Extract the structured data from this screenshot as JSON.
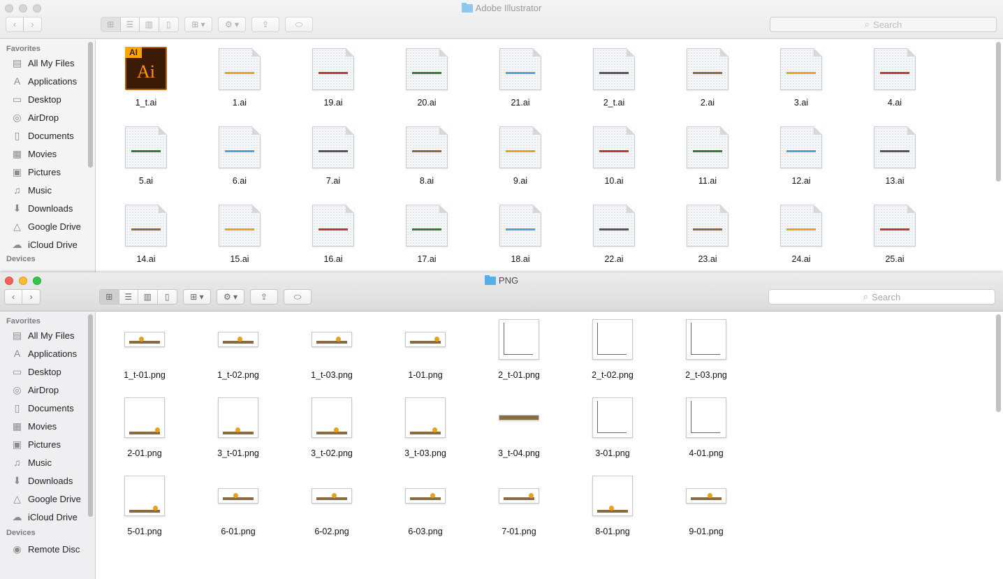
{
  "top_window": {
    "title": "Adobe Illustrator",
    "search_placeholder": "Search",
    "sidebar": {
      "favorites_heading": "Favorites",
      "items": [
        {
          "label": "All My Files",
          "icon": "all-files-icon",
          "glyph": "▤"
        },
        {
          "label": "Applications",
          "icon": "applications-icon",
          "glyph": "A"
        },
        {
          "label": "Desktop",
          "icon": "desktop-icon",
          "glyph": "▭"
        },
        {
          "label": "AirDrop",
          "icon": "airdrop-icon",
          "glyph": "◎"
        },
        {
          "label": "Documents",
          "icon": "documents-icon",
          "glyph": "▯"
        },
        {
          "label": "Movies",
          "icon": "movies-icon",
          "glyph": "▦"
        },
        {
          "label": "Pictures",
          "icon": "pictures-icon",
          "glyph": "▣"
        },
        {
          "label": "Music",
          "icon": "music-icon",
          "glyph": "♫"
        },
        {
          "label": "Downloads",
          "icon": "downloads-icon",
          "glyph": "⬇"
        },
        {
          "label": "Google Drive",
          "icon": "google-drive-icon",
          "glyph": "△"
        },
        {
          "label": "iCloud Drive",
          "icon": "icloud-icon",
          "glyph": "☁"
        }
      ],
      "devices_heading": "Devices"
    },
    "files": [
      "1_t.ai",
      "1.ai",
      "19.ai",
      "20.ai",
      "21.ai",
      "2_t.ai",
      "2.ai",
      "3.ai",
      "4.ai",
      "5.ai",
      "6.ai",
      "7.ai",
      "8.ai",
      "9.ai",
      "10.ai",
      "11.ai",
      "12.ai",
      "13.ai",
      "14.ai",
      "15.ai",
      "16.ai",
      "17.ai",
      "18.ai",
      "22.ai",
      "23.ai",
      "24.ai",
      "25.ai"
    ],
    "ai_badge": "AI",
    "ai_big": "Ai"
  },
  "bottom_window": {
    "title": "PNG",
    "search_placeholder": "Search",
    "sidebar": {
      "favorites_heading": "Favorites",
      "items": [
        {
          "label": "All My Files",
          "icon": "all-files-icon",
          "glyph": "▤"
        },
        {
          "label": "Applications",
          "icon": "applications-icon",
          "glyph": "A"
        },
        {
          "label": "Desktop",
          "icon": "desktop-icon",
          "glyph": "▭"
        },
        {
          "label": "AirDrop",
          "icon": "airdrop-icon",
          "glyph": "◎"
        },
        {
          "label": "Documents",
          "icon": "documents-icon",
          "glyph": "▯"
        },
        {
          "label": "Movies",
          "icon": "movies-icon",
          "glyph": "▦"
        },
        {
          "label": "Pictures",
          "icon": "pictures-icon",
          "glyph": "▣"
        },
        {
          "label": "Music",
          "icon": "music-icon",
          "glyph": "♫"
        },
        {
          "label": "Downloads",
          "icon": "downloads-icon",
          "glyph": "⬇"
        },
        {
          "label": "Google Drive",
          "icon": "google-drive-icon",
          "glyph": "△"
        },
        {
          "label": "iCloud Drive",
          "icon": "icloud-icon",
          "glyph": "☁"
        }
      ],
      "devices_heading": "Devices",
      "devices": [
        {
          "label": "Remote Disc",
          "icon": "remote-disc-icon",
          "glyph": "◉"
        }
      ]
    },
    "files": [
      "1_t-01.png",
      "1_t-02.png",
      "1_t-03.png",
      "1-01.png",
      "2_t-01.png",
      "2_t-02.png",
      "2_t-03.png",
      "2-01.png",
      "3_t-01.png",
      "3_t-02.png",
      "3_t-03.png",
      "3_t-04.png",
      "3-01.png",
      "4-01.png",
      "5-01.png",
      "6-01.png",
      "6-02.png",
      "6-03.png",
      "7-01.png",
      "8-01.png",
      "9-01.png"
    ]
  },
  "colors": {
    "close": "#fc5f57",
    "minimize": "#fdbc2e",
    "zoom": "#33c748",
    "folder": "#5aaee8"
  }
}
